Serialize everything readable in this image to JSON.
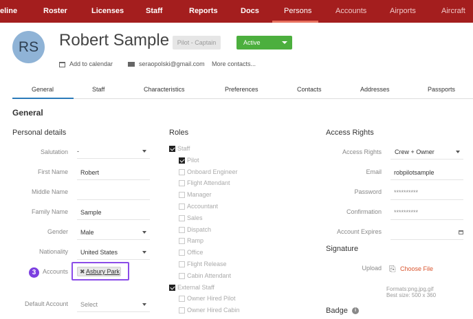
{
  "nav": {
    "items": [
      {
        "label": "eline",
        "state": "normal"
      },
      {
        "label": "Roster",
        "state": "normal"
      },
      {
        "label": "Licenses",
        "state": "normal"
      },
      {
        "label": "Staff",
        "state": "normal"
      },
      {
        "label": "Reports",
        "state": "normal"
      },
      {
        "label": "Docs",
        "state": "normal"
      },
      {
        "label": "Persons",
        "state": "active"
      },
      {
        "label": "Accounts",
        "state": "dim"
      },
      {
        "label": "Airports",
        "state": "dim"
      },
      {
        "label": "Aircraft",
        "state": "dim"
      }
    ]
  },
  "header": {
    "initials": "RS",
    "name": "Robert Sample",
    "role_badge": "Pilot - Captain",
    "status": "Active",
    "add_to_calendar": "Add to calendar",
    "email": "seraopolski@gmail.com",
    "more_contacts": "More contacts..."
  },
  "tabs": [
    "General",
    "Staff",
    "Characteristics",
    "Preferences",
    "Contacts",
    "Addresses",
    "Passports"
  ],
  "section_title": "General",
  "personal": {
    "title": "Personal details",
    "salutation": {
      "label": "Salutation",
      "value": "-"
    },
    "first_name": {
      "label": "First Name",
      "value": "Robert"
    },
    "middle_name": {
      "label": "Middle Name",
      "value": ""
    },
    "family_name": {
      "label": "Family Name",
      "value": "Sample"
    },
    "gender": {
      "label": "Gender",
      "value": "Male"
    },
    "nationality": {
      "label": "Nationality",
      "value": "United States"
    },
    "accounts": {
      "label": "Accounts",
      "chip": "Asbury Park",
      "step": "3"
    },
    "default_account": {
      "label": "Default Account",
      "placeholder": "Select"
    }
  },
  "roles": {
    "title": "Roles",
    "items": [
      {
        "label": "Staff",
        "checked": true,
        "level": 0
      },
      {
        "label": "Pilot",
        "checked": true,
        "level": 1
      },
      {
        "label": "Onboard Engineer",
        "checked": false,
        "level": 1
      },
      {
        "label": "Flight Attendant",
        "checked": false,
        "level": 1
      },
      {
        "label": "Manager",
        "checked": false,
        "level": 1
      },
      {
        "label": "Accountant",
        "checked": false,
        "level": 1
      },
      {
        "label": "Sales",
        "checked": false,
        "level": 1
      },
      {
        "label": "Dispatch",
        "checked": false,
        "level": 1
      },
      {
        "label": "Ramp",
        "checked": false,
        "level": 1
      },
      {
        "label": "Office",
        "checked": false,
        "level": 1
      },
      {
        "label": "Flight Release",
        "checked": false,
        "level": 1
      },
      {
        "label": "Cabin Attendant",
        "checked": false,
        "level": 1
      },
      {
        "label": "External Staff",
        "checked": true,
        "level": 0
      },
      {
        "label": "Owner Hired Pilot",
        "checked": false,
        "level": 1
      },
      {
        "label": "Owner Hired Cabin",
        "checked": false,
        "level": 1
      }
    ]
  },
  "access": {
    "title": "Access Rights",
    "access_rights": {
      "label": "Access Rights",
      "value": "Crew + Owner"
    },
    "email": {
      "label": "Email",
      "value": "robpilotsample"
    },
    "password": {
      "label": "Password",
      "value": "**********"
    },
    "confirmation": {
      "label": "Confirmation",
      "value": "**********"
    },
    "expires": {
      "label": "Account Expires",
      "value": ""
    }
  },
  "signature": {
    "title": "Signature",
    "upload_label": "Upload",
    "choose_file": "Choose File",
    "formats": "Formats:png,jpg,gif",
    "best_size": "Best size: 500 x 360"
  },
  "badge": {
    "title": "Badge",
    "info": "i"
  },
  "colors": {
    "nav_bg": "#a41e1e",
    "active_status": "#4caf3e",
    "tab_active": "#2a7ab9",
    "highlight": "#8a4be8",
    "link_orange": "#d9532c"
  }
}
